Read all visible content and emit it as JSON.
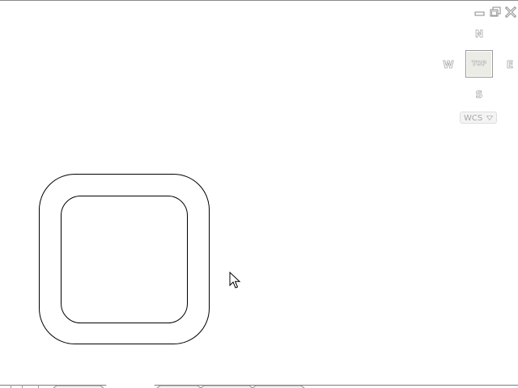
{
  "viewcube": {
    "north": "N",
    "south": "S",
    "east": "E",
    "west": "W",
    "face": "TOP",
    "ucs_menu": {
      "label": "WCS"
    }
  },
  "window_controls": [
    "minimize-icon",
    "restore-icon",
    "close-icon"
  ],
  "drawing": {
    "objects": [
      "outer-rounded-square",
      "inner-rounded-square"
    ]
  },
  "cursor": "arrow-cursor-icon",
  "colors": {
    "background": "#ffffff",
    "geometry_stroke": "#000000",
    "viewcube_gray": "#a8a8a8"
  }
}
